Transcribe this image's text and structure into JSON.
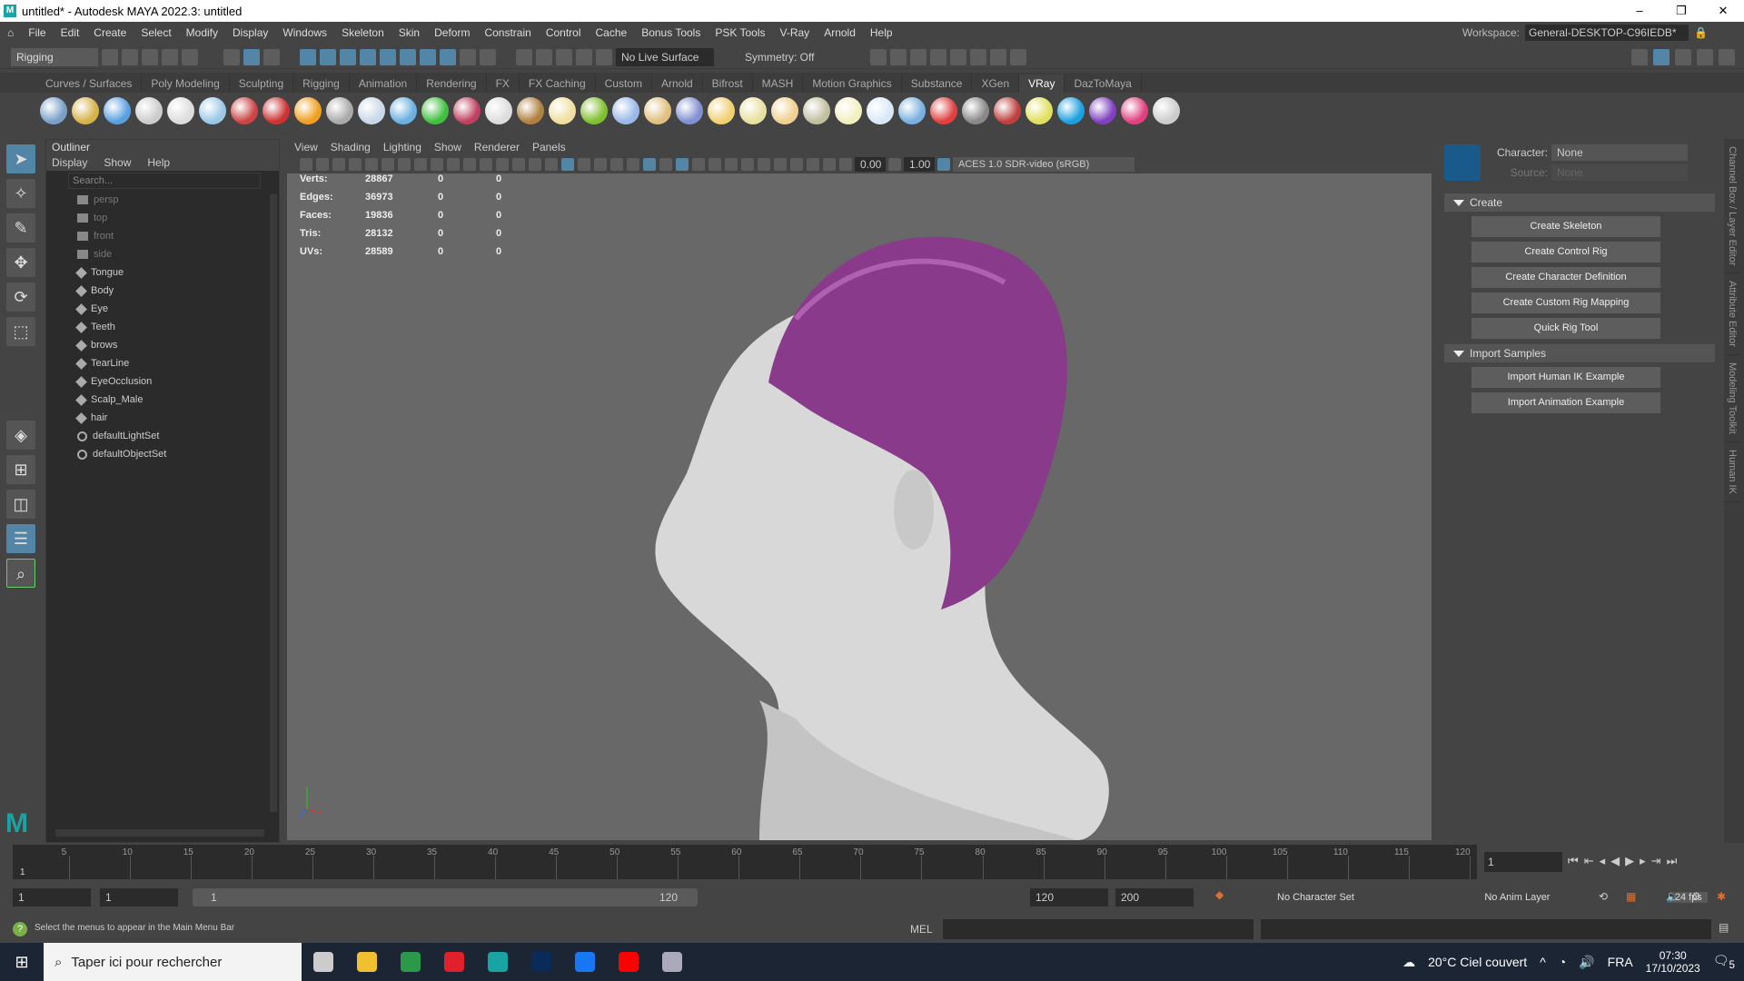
{
  "window": {
    "title": "untitled* - Autodesk MAYA 2022.3: untitled",
    "logo": "M",
    "controls": [
      "–",
      "❐",
      "✕"
    ]
  },
  "menu": [
    "File",
    "Edit",
    "Create",
    "Select",
    "Modify",
    "Display",
    "Windows",
    "Skeleton",
    "Skin",
    "Deform",
    "Constrain",
    "Control",
    "Cache",
    "Bonus Tools",
    "PSK Tools",
    "V-Ray",
    "Arnold",
    "Help"
  ],
  "workspace": {
    "label": "Workspace:",
    "value": "General-DESKTOP-C96IEDB*"
  },
  "toolbar": {
    "menuset": "Rigging",
    "live_surface": "No Live Surface",
    "symmetry": "Symmetry: Off"
  },
  "shelf": {
    "tabs": [
      "Curves / Surfaces",
      "Poly Modeling",
      "Sculpting",
      "Rigging",
      "Animation",
      "Rendering",
      "FX",
      "FX Caching",
      "Custom",
      "Arnold",
      "Bifrost",
      "MASH",
      "Motion Graphics",
      "Substance",
      "XGen",
      "VRay",
      "DazToMaya"
    ],
    "active": "VRay",
    "icon_colors": [
      "#7aa0c8",
      "#d6b24a",
      "#5aa0e0",
      "#ccc",
      "#ddd",
      "#9cc8e8",
      "#c44",
      "#c33",
      "#f0a020",
      "#aaa",
      "#c8d8e8",
      "#6ab0e0",
      "#40c040",
      "#c04060",
      "#ddd",
      "#b08040",
      "#f0e0a0",
      "#80c030",
      "#9ab8e8",
      "#e0c080",
      "#8090d0",
      "#f0d070",
      "#e8e0a0",
      "#f0d090",
      "#c0c0a0",
      "#f0f0c0",
      "#d8e8f8",
      "#7ab0e0",
      "#e04040",
      "#888",
      "#c04040",
      "#e0e060",
      "#1ea0e0",
      "#8040c0",
      "#e04080",
      "#ccc"
    ]
  },
  "outliner": {
    "title": "Outliner",
    "menu": [
      "Display",
      "Show",
      "Help"
    ],
    "search_placeholder": "Search...",
    "items": [
      {
        "name": "persp",
        "type": "cam"
      },
      {
        "name": "top",
        "type": "cam"
      },
      {
        "name": "front",
        "type": "cam"
      },
      {
        "name": "side",
        "type": "cam"
      },
      {
        "name": "Tongue",
        "type": "mesh"
      },
      {
        "name": "Body",
        "type": "mesh"
      },
      {
        "name": "Eye",
        "type": "mesh"
      },
      {
        "name": "Teeth",
        "type": "mesh"
      },
      {
        "name": "brows",
        "type": "mesh"
      },
      {
        "name": "TearLine",
        "type": "mesh"
      },
      {
        "name": "EyeOcclusion",
        "type": "mesh"
      },
      {
        "name": "Scalp_Male",
        "type": "mesh"
      },
      {
        "name": "hair",
        "type": "mesh"
      },
      {
        "name": "defaultLightSet",
        "type": "set"
      },
      {
        "name": "defaultObjectSet",
        "type": "set"
      }
    ]
  },
  "viewport": {
    "menu": [
      "View",
      "Shading",
      "Lighting",
      "Show",
      "Renderer",
      "Panels"
    ],
    "exposure": "0.00",
    "gamma": "1.00",
    "colorspace": "ACES 1.0 SDR-video (sRGB)",
    "stats": [
      [
        "Verts:",
        "28867",
        "0",
        "0"
      ],
      [
        "Edges:",
        "36973",
        "0",
        "0"
      ],
      [
        "Faces:",
        "19836",
        "0",
        "0"
      ],
      [
        "Tris:",
        "28132",
        "0",
        "0"
      ],
      [
        "UVs:",
        "28589",
        "0",
        "0"
      ]
    ],
    "hair_color": "#8a3a8a"
  },
  "hik": {
    "character_label": "Character:",
    "character": "None",
    "source_label": "Source:",
    "source": "None",
    "sections": [
      {
        "title": "Create",
        "buttons": [
          "Create Skeleton",
          "Create Control Rig",
          "Create Character Definition",
          "Create Custom Rig Mapping",
          "Quick Rig Tool"
        ]
      },
      {
        "title": "Import Samples",
        "buttons": [
          "Import Human IK Example",
          "Import Animation Example"
        ]
      }
    ]
  },
  "side_tabs": [
    "Channel Box / Layer Editor",
    "Attribute Editor",
    "Modeling Toolkit",
    "Human IK"
  ],
  "timeline": {
    "ticks": [
      5,
      10,
      15,
      20,
      25,
      30,
      35,
      40,
      45,
      50,
      55,
      60,
      65,
      70,
      75,
      80,
      85,
      90,
      95,
      100,
      105,
      110,
      115,
      120
    ],
    "current": "1",
    "current_frame_field": "1",
    "max": 120
  },
  "range": {
    "start": "1",
    "playback_start": "1",
    "slider_start": "1",
    "slider_end": "120",
    "playback_end": "120",
    "end": "200",
    "character_set": "No Character Set",
    "anim_layer": "No Anim Layer",
    "fps": "24 fps"
  },
  "status": {
    "help": "Select the menus to appear in the Main Menu Bar",
    "mel": "MEL"
  },
  "taskbar": {
    "search": "Taper ici pour rechercher",
    "weather": "20°C  Ciel couvert",
    "lang": "FRA",
    "time": "07:30",
    "date": "17/10/2023",
    "notif": "5",
    "apps": [
      {
        "name": "task-view",
        "color": "#ccc"
      },
      {
        "name": "file-explorer",
        "color": "#f0c030"
      },
      {
        "name": "chrome",
        "color": "#2a9a4a"
      },
      {
        "name": "opera",
        "color": "#e0202a"
      },
      {
        "name": "maya",
        "color": "#1aa3a3"
      },
      {
        "name": "photoshop",
        "color": "#0a2a5a"
      },
      {
        "name": "facebook",
        "color": "#1877f2"
      },
      {
        "name": "youtube",
        "color": "#ff0000"
      },
      {
        "name": "app",
        "color": "#aab"
      }
    ]
  }
}
